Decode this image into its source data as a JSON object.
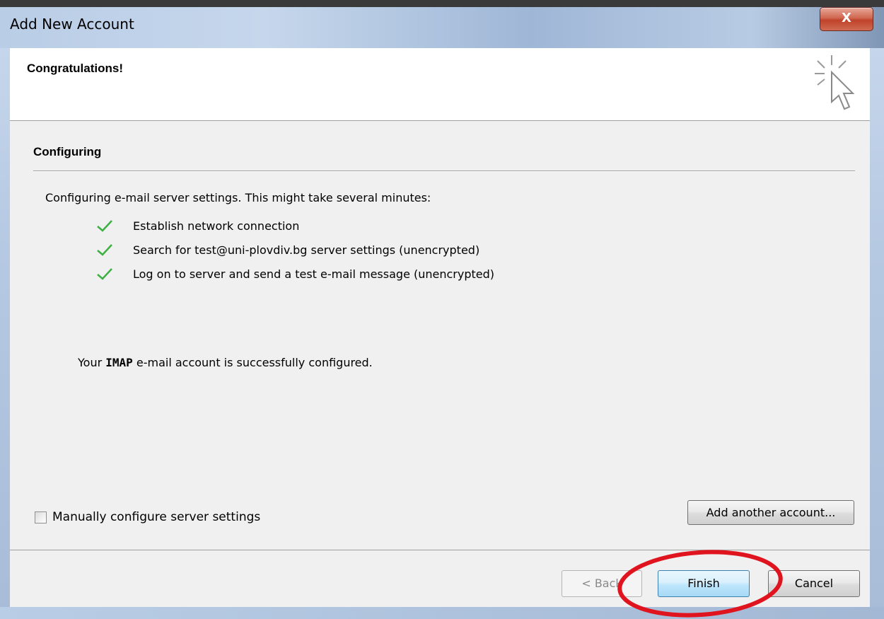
{
  "window": {
    "title": "Add New Account",
    "close_label": "X"
  },
  "header": {
    "title": "Congratulations!"
  },
  "section": {
    "title": "Configuring",
    "description": "Configuring e-mail server settings. This might take several minutes:"
  },
  "steps": [
    {
      "label": "Establish network connection",
      "status": "done"
    },
    {
      "label": "Search for test@uni-plovdiv.bg server settings (unencrypted)",
      "status": "done"
    },
    {
      "label": "Log on to server and send a test e-mail message (unencrypted)",
      "status": "done"
    }
  ],
  "result": {
    "prefix": "Your ",
    "account_type": "IMAP",
    "suffix": " e-mail account is successfully configured."
  },
  "options": {
    "manual_config_label": "Manually configure server settings",
    "manual_config_checked": false,
    "add_another_label": "Add another account..."
  },
  "footer": {
    "back_label": "< Back",
    "finish_label": "Finish",
    "cancel_label": "Cancel"
  },
  "colors": {
    "check_green": "#3cb043",
    "highlight_red": "#e0141e"
  }
}
